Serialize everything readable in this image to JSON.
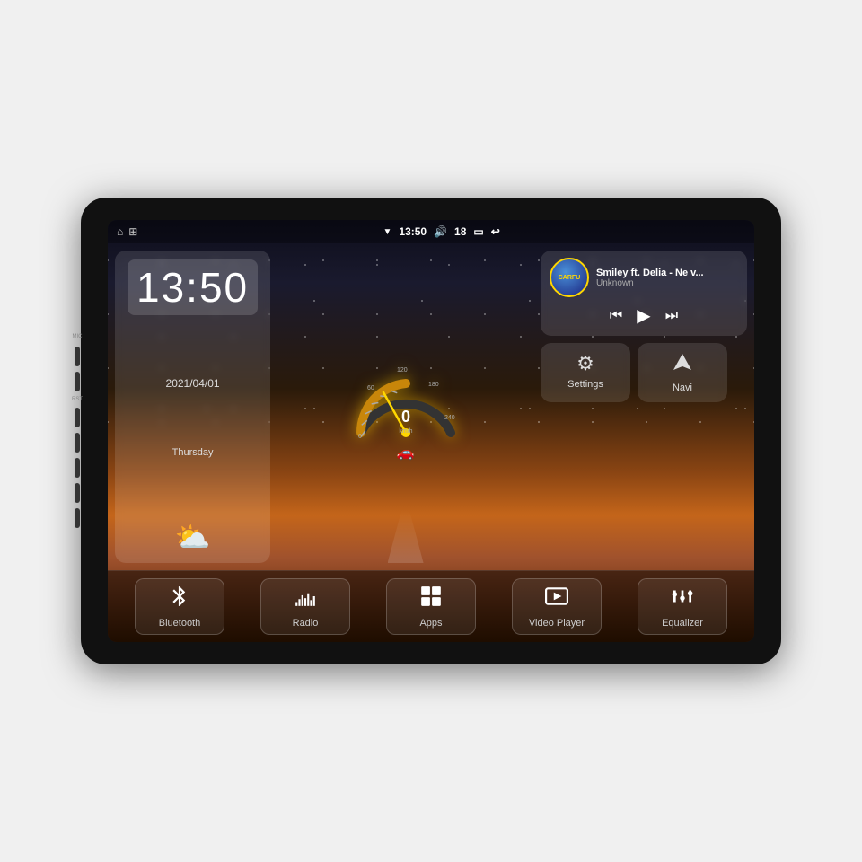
{
  "device": {
    "title": "Car Android Head Unit"
  },
  "status_bar": {
    "wifi_icon": "▼",
    "time": "13:50",
    "volume_icon": "🔊",
    "volume_level": "18",
    "battery_icon": "▭",
    "back_icon": "↩",
    "home_icon": "⌂",
    "app_icon": "⊞"
  },
  "clock": {
    "time": "13:50",
    "date": "2021/04/01",
    "day": "Thursday",
    "weather_emoji": "⛅"
  },
  "speedometer": {
    "value": "0",
    "unit": "km/h",
    "max": "240"
  },
  "music": {
    "title": "Smiley ft. Delia - Ne v...",
    "artist": "Unknown",
    "album_label": "CARFU",
    "prev_icon": "⏮",
    "play_icon": "▶",
    "next_icon": "⏭"
  },
  "quick_buttons": {
    "settings": {
      "icon": "⚙",
      "label": "Settings"
    },
    "navi": {
      "icon": "⛶",
      "label": "Navi"
    }
  },
  "dock": {
    "items": [
      {
        "icon": "bluetooth",
        "label": "Bluetooth"
      },
      {
        "icon": "radio",
        "label": "Radio"
      },
      {
        "icon": "apps",
        "label": "Apps"
      },
      {
        "icon": "video",
        "label": "Video Player"
      },
      {
        "icon": "equalizer",
        "label": "Equalizer"
      }
    ]
  },
  "side_buttons": {
    "mic_label": "MIC",
    "rst_label": "RST"
  }
}
